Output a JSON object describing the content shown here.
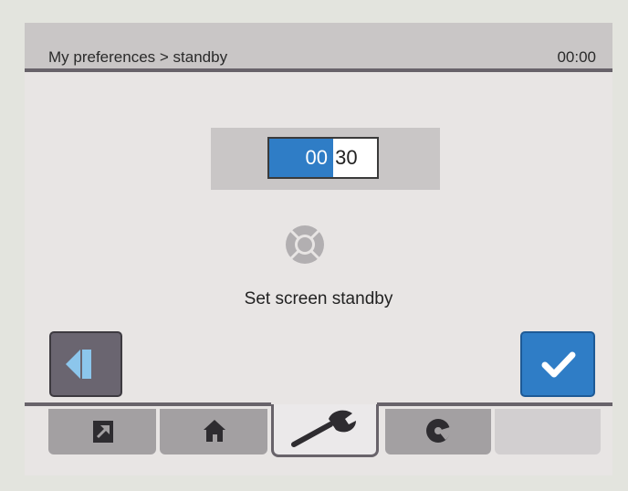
{
  "header": {
    "breadcrumb": "My preferences > standby",
    "clock": "00:00"
  },
  "time_field": {
    "hours": "00",
    "separator": ":",
    "minutes": "30",
    "selected_segment": "hours"
  },
  "instruction": "Set screen standby",
  "buttons": {
    "back": "back-icon",
    "confirm": "check-icon"
  },
  "tabs": [
    {
      "icon": "export-icon",
      "active": false
    },
    {
      "icon": "home-icon",
      "active": false
    },
    {
      "icon": "wrench-icon",
      "active": true
    },
    {
      "icon": "disc-icon",
      "active": false
    },
    {
      "icon": "",
      "active": false
    }
  ],
  "colors": {
    "accent": "#2f7dc6",
    "header_bg": "#c9c6c6",
    "tab_bg": "#a3a0a2",
    "dark": "#68636a"
  }
}
